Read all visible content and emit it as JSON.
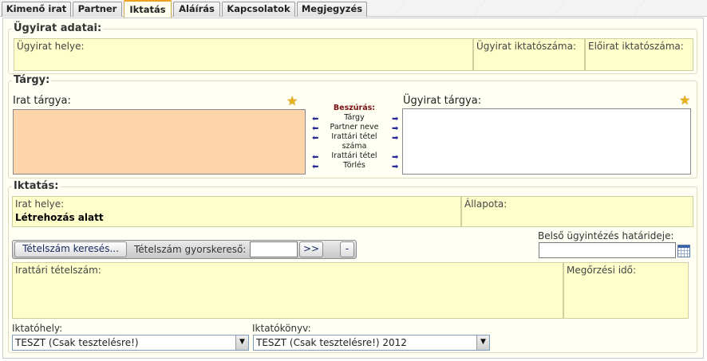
{
  "tabs": [
    {
      "label": "Kimenő irat",
      "active": false
    },
    {
      "label": "Partner",
      "active": false
    },
    {
      "label": "Iktatás",
      "active": true
    },
    {
      "label": "Aláírás",
      "active": false
    },
    {
      "label": "Kapcsolatok",
      "active": false
    },
    {
      "label": "Megjegyzés",
      "active": false
    }
  ],
  "ugyirat": {
    "legend": "Ügyirat adatai:",
    "hely_label": "Ügyirat helye:",
    "iktatoszam_label": "Ügyirat iktatószáma:",
    "eloirat_label": "Előirat iktatószáma:"
  },
  "targy": {
    "legend": "Tárgy:",
    "irat_targya_label": "Irat tárgya:",
    "ugyirat_targya_label": "Ügyirat tárgya:",
    "beszuras": {
      "title": "Beszúrás:",
      "items": [
        "Tárgy",
        "Partner neve",
        "Irattári tétel száma",
        "Irattári tétel",
        "Törlés"
      ]
    }
  },
  "iktatas": {
    "legend": "Iktatás:",
    "irat_helye_label": "Irat helye:",
    "irat_helye_value": "Létrehozás alatt",
    "allapota_label": "Állapota:",
    "tetelszam_kereses_button": "Tételszám keresés...",
    "gyorskereso_label": "Tételszám gyorskereső:",
    "gyorskereso_value": "",
    "go_button": ">>",
    "clear_button": "-",
    "hatarido_label": "Belső ügyintézés határideje:",
    "hatarido_value": "",
    "irattari_tetelszam_label": "Irattári tételszám:",
    "megorzesi_ido_label": "Megőrzési idő:",
    "iktatohely_label": "Iktatóhely:",
    "iktatohely_value": "TESZT (Csak tesztelésre!)",
    "iktatokonyv_label": "Iktatókönyv:",
    "iktatokonyv_value": "TESZT (Csak tesztelésre!) 2012"
  },
  "icons": {
    "star": "star-icon",
    "arrow_left": "arrow-left-icon",
    "arrow_right": "arrow-right-icon",
    "calendar": "calendar-icon",
    "dropdown": "chevron-down-icon"
  },
  "colors": {
    "active_tab_border": "#f0a020",
    "cell_background": "#ffffcc",
    "irat_targya_background": "#fcd5ac",
    "panel_background": "#fffff4"
  }
}
